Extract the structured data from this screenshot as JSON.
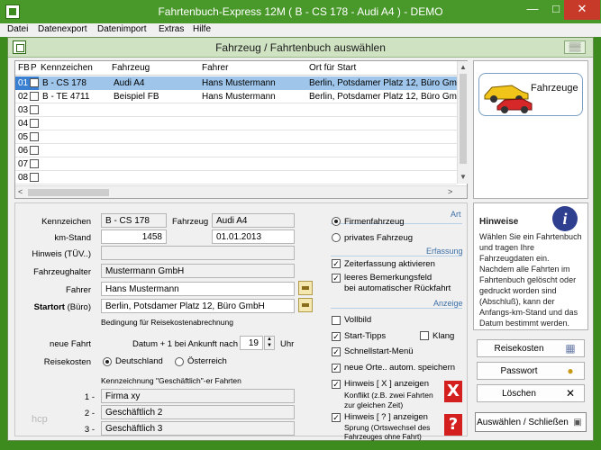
{
  "window": {
    "title": "Fahrtenbuch-Express 12M ( B - CS 178 - Audi A4 ) - DEMO"
  },
  "menu": [
    "Datei",
    "Datenexport",
    "Datenimport",
    "Extras",
    "Hilfe"
  ],
  "dialog": {
    "title": "Fahrzeug / Fahrtenbuch auswählen"
  },
  "grid": {
    "headers": {
      "fb": "FB",
      "p": "P",
      "kennzeichen": "Kennzeichen",
      "fahrzeug": "Fahrzeug",
      "fahrer": "Fahrer",
      "ort": "Ort für Start"
    },
    "rows": [
      {
        "fb": "01",
        "kennzeichen": "B - CS 178",
        "fahrzeug": "Audi A4",
        "fahrer": "Hans Mustermann",
        "ort": "Berlin, Potsdamer Platz 12, Büro GmbH"
      },
      {
        "fb": "02",
        "kennzeichen": "B - TE 4711",
        "fahrzeug": "Beispiel FB",
        "fahrer": "Hans Mustermann",
        "ort": "Berlin, Potsdamer Platz 12, Büro GmbH"
      },
      {
        "fb": "03",
        "kennzeichen": "",
        "fahrzeug": "",
        "fahrer": "",
        "ort": ""
      },
      {
        "fb": "04",
        "kennzeichen": "",
        "fahrzeug": "",
        "fahrer": "",
        "ort": ""
      },
      {
        "fb": "05",
        "kennzeichen": "",
        "fahrzeug": "",
        "fahrer": "",
        "ort": ""
      },
      {
        "fb": "06",
        "kennzeichen": "",
        "fahrzeug": "",
        "fahrer": "",
        "ort": ""
      },
      {
        "fb": "07",
        "kennzeichen": "",
        "fahrzeug": "",
        "fahrer": "",
        "ort": ""
      },
      {
        "fb": "08",
        "kennzeichen": "",
        "fahrzeug": "",
        "fahrer": "",
        "ort": ""
      }
    ]
  },
  "form": {
    "kennzeichen_label": "Kennzeichen",
    "kennzeichen": "B - CS 178",
    "fahrzeug_label": "Fahrzeug",
    "fahrzeug": "Audi A4",
    "kmstand_label": "km-Stand",
    "kmstand": "1458",
    "datum": "01.01.2013",
    "hinweis_label": "Hinweis (TÜV..)",
    "hinweis": "",
    "halter_label": "Fahrzeughalter",
    "halter": "Mustermann GmbH",
    "fahrer_label": "Fahrer",
    "fahrer": "Hans Mustermann",
    "startort_label": "Startort",
    "startort_suffix": "(Büro)",
    "startort": "Berlin, Potsdamer Platz 12, Büro GmbH",
    "bedingung_label": "Bedingung für Reisekostenabrechnung",
    "neuefahrt_label": "neue Fahrt",
    "neuefahrt_text": "Datum + 1 bei Ankunft nach",
    "uhr_value": "19",
    "uhr_label": "Uhr",
    "reisekosten_label": "Reisekosten",
    "land_de": "Deutschland",
    "land_at": "Österreich",
    "kennzeichnung_label": "Kennzeichnung \"Geschäftlich\"-er Fahrten",
    "gesch": [
      {
        "n": "1 -",
        "v": "Firma xy"
      },
      {
        "n": "2 -",
        "v": "Geschäftlich 2"
      },
      {
        "n": "3 -",
        "v": "Geschäftlich 3"
      }
    ],
    "watermark": "hcp"
  },
  "options": {
    "art_label": "Art",
    "firmenfahrzeug": "Firmenfahrzeug",
    "privates_fahrzeug": "privates Fahrzeug",
    "erfassung_label": "Erfassung",
    "zeiterfassung": "Zeiterfassung aktivieren",
    "bemerkung_1": "leeres Bemerkungsfeld",
    "bemerkung_2": "bei automatischer Rückfahrt",
    "anzeige_label": "Anzeige",
    "vollbild": "Vollbild",
    "starttipps": "Start-Tipps",
    "klang": "Klang",
    "schnellstart": "Schnellstart-Menü",
    "neue_orte": "neue Orte.. autom. speichern",
    "hinweis_x": "Hinweis [ X ] anzeigen",
    "hinweis_x_sub1": "Konflikt (z.B. zwei Fahrten",
    "hinweis_x_sub2": "zur gleichen Zeit)",
    "hinweis_q": "Hinweis [ ? ] anzeigen",
    "hinweis_q_sub1": "Sprung (Ortswechsel des",
    "hinweis_q_sub2": "Fahrzeuges ohne Fahrt)",
    "x_glyph": "X",
    "q_glyph": "?"
  },
  "right": {
    "fahrzeuge": "Fahrzeuge",
    "hint_title": "Hinweise",
    "hint_text": "Wählen Sie ein Fahrtenbuch und tragen Ihre Fahrzeugdaten ein. Nachdem alle Fahrten im Fahrtenbuch gelöscht oder gedruckt worden sind (Abschluß), kann der Anfangs-km-Stand und das Datum bestimmt werden.",
    "info_glyph": "i"
  },
  "buttons": {
    "reisekosten": "Reisekosten",
    "passwort": "Passwort",
    "loeschen": "Löschen",
    "auswaehlen": "Auswählen / Schließen"
  },
  "colors": {
    "titlebar": "#49982a",
    "selection": "#9fc6ea",
    "selection_first": "#3a80d2",
    "red": "#d41f1f",
    "info": "#2f3f8f"
  }
}
